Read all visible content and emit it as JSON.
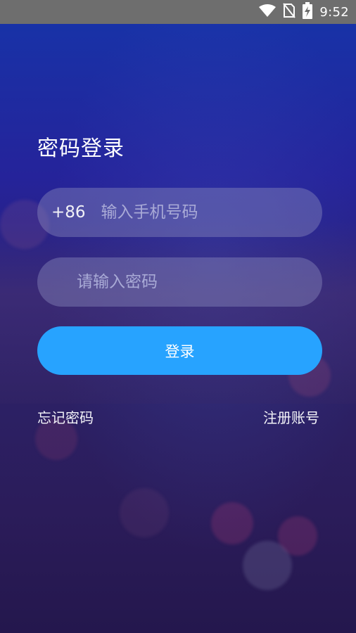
{
  "status_bar": {
    "time": "9:52",
    "icons": [
      "wifi-icon",
      "no-sim-icon",
      "battery-charging-icon"
    ]
  },
  "login": {
    "title": "密码登录",
    "phone_field": {
      "country_code": "+86",
      "placeholder": "输入手机号码",
      "value": ""
    },
    "password_field": {
      "placeholder": "请输入密码",
      "value": ""
    },
    "login_button_label": "登录",
    "forgot_password_label": "忘记密码",
    "register_label": "注册账号"
  },
  "colors": {
    "accent": "#27a3ff",
    "status_bar_bg": "#6e6e6e",
    "background_top": "#1832a7",
    "background_bottom": "#24174d"
  }
}
